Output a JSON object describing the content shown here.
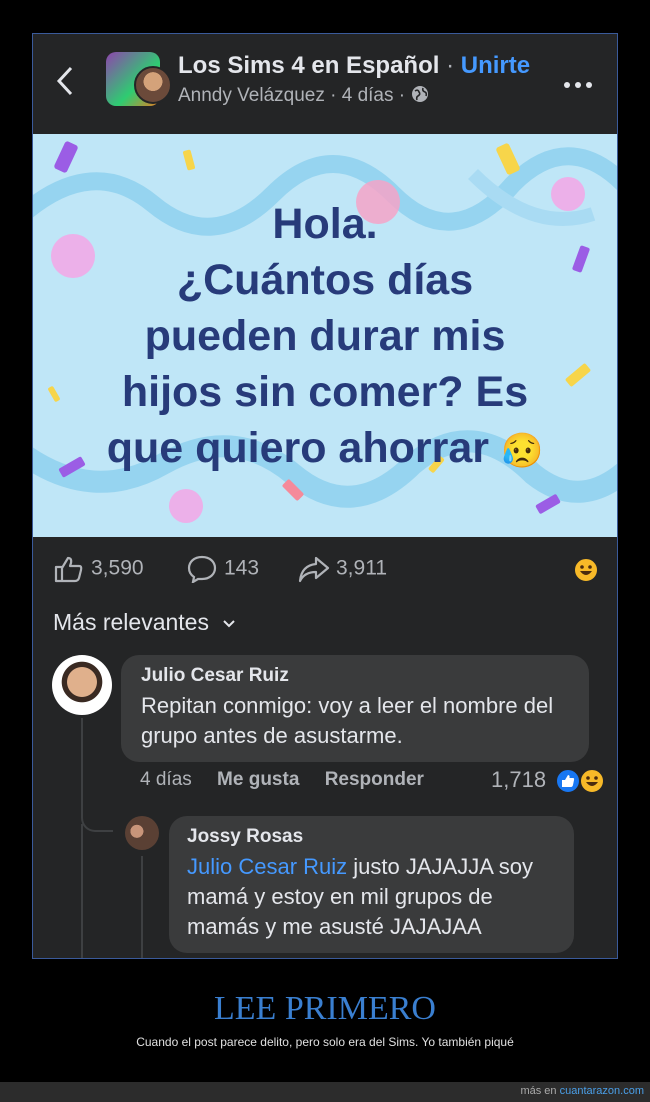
{
  "header": {
    "group_name": "Los Sims 4 en Español",
    "separator": "·",
    "join_label": "Unirte",
    "author": "Anndy Velázquez",
    "time": "4 días",
    "back_icon": "chevron-left-icon",
    "more_icon": "more-horizontal-icon",
    "privacy_icon": "globe-icon"
  },
  "post": {
    "lines": [
      "Hola.",
      "¿Cuántos días",
      "pueden durar mis",
      "hijos sin comer? Es",
      "que quiero ahorrar"
    ],
    "emoji": "😥",
    "background_color": "#bfe6f7",
    "text_color": "#273b7a"
  },
  "actions": {
    "likes": "3,590",
    "comments": "143",
    "shares": "3,911"
  },
  "comments_section": {
    "sort_label": "Más relevantes",
    "comment": {
      "author": "Julio Cesar Ruiz",
      "text": "Repitan conmigo: voy a leer el nombre del grupo antes de asustarme.",
      "time": "4 días",
      "like_label": "Me gusta",
      "reply_label": "Responder",
      "reaction_count": "1,718"
    },
    "reply": {
      "author": "Jossy Rosas",
      "mention": "Julio Cesar Ruiz",
      "text": " justo JAJAJJA soy mamá y estoy en mil grupos de mamás y me asusté JAJAJAA"
    }
  },
  "caption": {
    "title": "LEE PRIMERO",
    "subtitle": "Cuando el post parece delito, pero solo era del Sims. Yo también piqué"
  },
  "footer": {
    "prefix": "más en ",
    "site": "cuantarazon.com"
  },
  "colors": {
    "accent": "#4599ff",
    "panel": "#242526",
    "bubble": "#3a3b3c"
  }
}
